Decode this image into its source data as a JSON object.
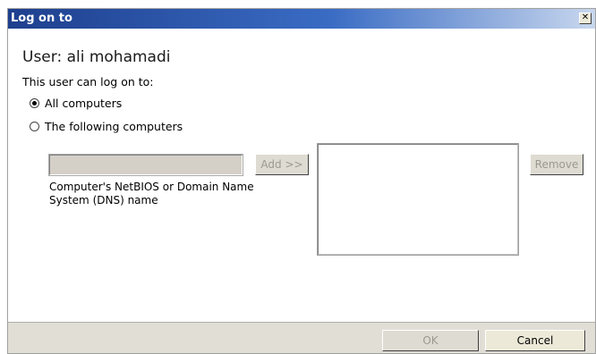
{
  "window": {
    "title": "Log on to",
    "close_symbol": "✕"
  },
  "user": {
    "heading": "User: ali mohamadi"
  },
  "logon": {
    "description": "This user can log on to:",
    "options": [
      {
        "label": "All computers",
        "selected": true
      },
      {
        "label": "The following computers",
        "selected": false
      }
    ]
  },
  "computer_name": {
    "value": "",
    "caption": "Computer's NetBIOS or Domain Name System (DNS) name"
  },
  "buttons": {
    "add": "Add >>",
    "remove": "Remove",
    "ok": "OK",
    "cancel": "Cancel"
  },
  "computers_list": {
    "items": []
  },
  "colors": {
    "titlebar_start": "#1e3f8e",
    "titlebar_end": "#c8d7ee",
    "disabled_text": "#9c9a90"
  }
}
